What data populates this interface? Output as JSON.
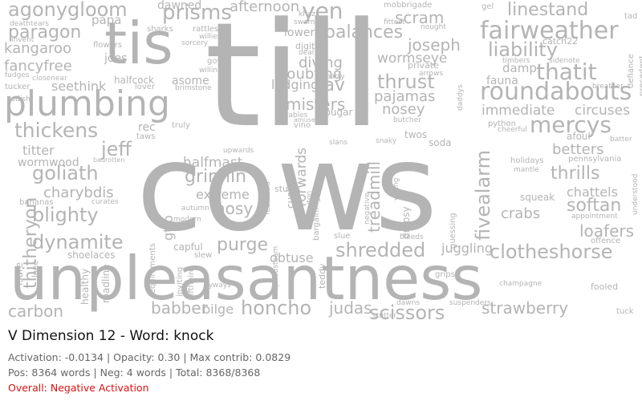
{
  "panel": {
    "title": "V Dimension 12 - Word: knock",
    "line1": "Activation: -0.0134 | Opacity: 0.30 | Max contrib: 0.0829",
    "line2": "Pos: 8364 words | Neg: 4 words | Total: 8368/8368",
    "overall": "Overall: Negative Activation",
    "overall_color": "#dd1111"
  },
  "cloud": {
    "word_color": "#b4b4b4",
    "words": [
      "cows",
      "till",
      "unpleasantness",
      "plumbing",
      "tis",
      "fairweather",
      "roundabouts",
      "mercys",
      "agonygloom",
      "yen",
      "prisms",
      "linestand",
      "paragon",
      "kangaroo",
      "fancyfree",
      "seethink",
      "balances",
      "joseph",
      "wormseye",
      "liability",
      "thatit",
      "diving",
      "doubting",
      "thrust",
      "lodging",
      "sav",
      "pajamas",
      "misters",
      "nosey",
      "immediate",
      "circuses",
      "thickens",
      "jeff",
      "goliath",
      "blighty",
      "dynamite",
      "charybdis",
      "grinnin",
      "halfmast",
      "extreme",
      "nosy",
      "purge",
      "shredded",
      "fivealarm",
      "treadmill",
      "forwards",
      "betters",
      "thrills",
      "softan",
      "chattels",
      "crabs",
      "loafers",
      "clotheshorse",
      "juggling",
      "honcho",
      "scissors",
      "strawberry",
      "babber",
      "bilge",
      "carbon",
      "judas",
      "titter",
      "wormwood",
      "thitheryon",
      "obtuse",
      "scram",
      "afternoon",
      "dawned",
      "papa",
      "lowered",
      "damp",
      "fauna",
      "gtfo",
      "tucker",
      "flowers",
      "sharks",
      "rattles",
      "willies",
      "joes",
      "asome",
      "halfcock",
      "rec",
      "taws",
      "truly",
      "vino",
      "tables",
      "amused",
      "cougar",
      "soda",
      "twos",
      "butcher",
      "python",
      "cheerful",
      "afoul",
      "batter",
      "pennsylvania",
      "holidays",
      "mantle",
      "appointment",
      "offence",
      "understood",
      "squeak",
      "guessing",
      "dropsy",
      "slans",
      "snaky",
      "voting",
      "private",
      "arrows",
      "bargaining",
      "cushy",
      "stuffe",
      "upwards",
      "slue",
      "bleeds",
      "grips",
      "suspenders",
      "dawns",
      "stutter",
      "champagne",
      "fooled",
      "tuck",
      "isare",
      "lone",
      "healthy",
      "roadline",
      "requirements",
      "inviting",
      "fifthbird",
      "byways",
      "speedsteam",
      "teddy",
      "shoelaces",
      "capful",
      "slew",
      "modern",
      "autumn",
      "bananas",
      "curates",
      "badrotten",
      "radish",
      "mobbrigade",
      "gel",
      "nought",
      "digits",
      "sorcery",
      "gown",
      "willin",
      "lover",
      "brimstone",
      "swamp",
      "khazi",
      "fittest",
      "catch22",
      "tad",
      "sidenote",
      "breather",
      "defiance",
      "precedent",
      "invent",
      "deathtears",
      "fudges",
      "closenear",
      "batty",
      "deal",
      "timbers",
      "daddys",
      "iton",
      "featheels",
      "negative",
      "ale"
    ]
  }
}
